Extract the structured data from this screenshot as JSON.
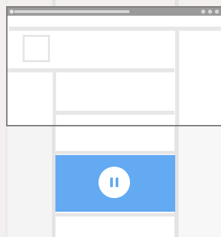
{
  "window": {
    "title_bar": {
      "title": "",
      "controls": [
        "dot",
        "dot",
        "dot"
      ]
    }
  },
  "media": {
    "state": "playing",
    "control": "pause",
    "accent_color": "#63aaf2"
  }
}
